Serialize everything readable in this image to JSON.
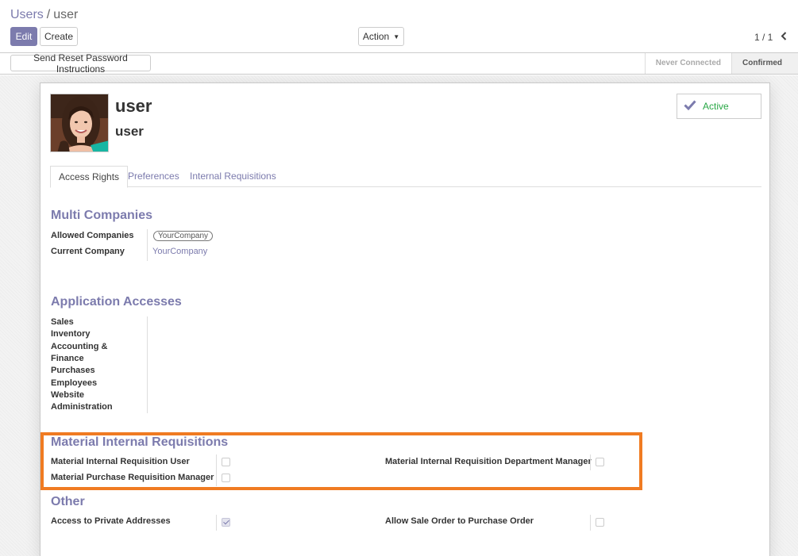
{
  "breadcrumb": {
    "parent": "Users",
    "separator": "/",
    "current": "user"
  },
  "toolbar": {
    "edit_label": "Edit",
    "create_label": "Create",
    "action_label": "Action"
  },
  "pager": {
    "value": "1 / 1"
  },
  "statusbar": {
    "reset_password_label": "Send Reset Password Instructions",
    "stages": [
      {
        "label": "Never Connected",
        "active": false
      },
      {
        "label": "Confirmed",
        "active": true
      }
    ]
  },
  "user": {
    "name": "user",
    "login": "user"
  },
  "active_toggle": {
    "label": "Active",
    "color": "#28a745"
  },
  "tabs": [
    {
      "label": "Access Rights",
      "active": true
    },
    {
      "label": "Preferences",
      "active": false
    },
    {
      "label": "Internal Requisitions",
      "active": false
    }
  ],
  "multi_companies": {
    "title": "Multi Companies",
    "allowed_label": "Allowed Companies",
    "allowed_tag": "YourCompany",
    "current_label": "Current Company",
    "current_value": "YourCompany"
  },
  "application_accesses": {
    "title": "Application Accesses",
    "items": [
      "Sales",
      "Inventory",
      "Accounting &",
      "Finance",
      "Purchases",
      "Employees",
      "Website",
      "Administration"
    ]
  },
  "material_requisitions": {
    "title": "Material Internal Requisitions",
    "user_label": "Material Internal Requisition User",
    "user_checked": false,
    "purchase_manager_label": "Material Purchase Requisition Manager",
    "purchase_manager_checked": false,
    "dept_manager_label": "Material Internal Requisition Department Manager",
    "dept_manager_checked": false
  },
  "other": {
    "title": "Other",
    "private_addresses_label": "Access to Private Addresses",
    "private_addresses_checked": true,
    "sale_to_purchase_label": "Allow Sale Order to Purchase Order",
    "sale_to_purchase_checked": false
  },
  "colors": {
    "brand": "#7c7bad",
    "highlight": "#f07b22",
    "active_green": "#28a745"
  }
}
